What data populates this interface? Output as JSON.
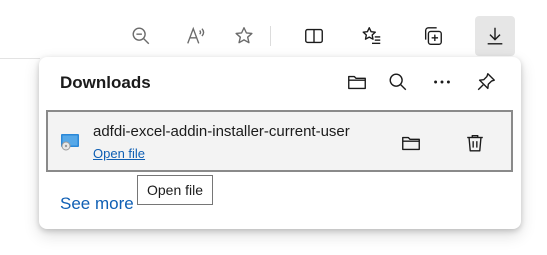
{
  "toolbar": {
    "buttons": [
      {
        "name": "zoom-out",
        "icon": "zoom-out-icon"
      },
      {
        "name": "read-aloud",
        "icon": "read-aloud-icon"
      },
      {
        "name": "favorite",
        "icon": "star-icon"
      },
      {
        "name": "split-screen",
        "icon": "split-screen-icon"
      },
      {
        "name": "favorites",
        "icon": "favorites-list-icon"
      },
      {
        "name": "collections",
        "icon": "collections-icon"
      },
      {
        "name": "downloads",
        "icon": "download-icon",
        "active": true
      }
    ]
  },
  "downloads_panel": {
    "title": "Downloads",
    "header_actions": [
      "open-folder-icon",
      "search-icon",
      "more-icon",
      "pin-icon"
    ],
    "items": [
      {
        "file_name": "adfdi-excel-addin-installer-current-user",
        "action_label": "Open file",
        "icon": "installer-file-icon"
      }
    ],
    "see_more_label": "See more"
  },
  "tooltip": {
    "text": "Open file"
  },
  "colors": {
    "link": "#0f5fb4",
    "item_background": "#f3f3f3",
    "item_border": "#8a8a8a",
    "active_button": "#e6e6e6"
  }
}
